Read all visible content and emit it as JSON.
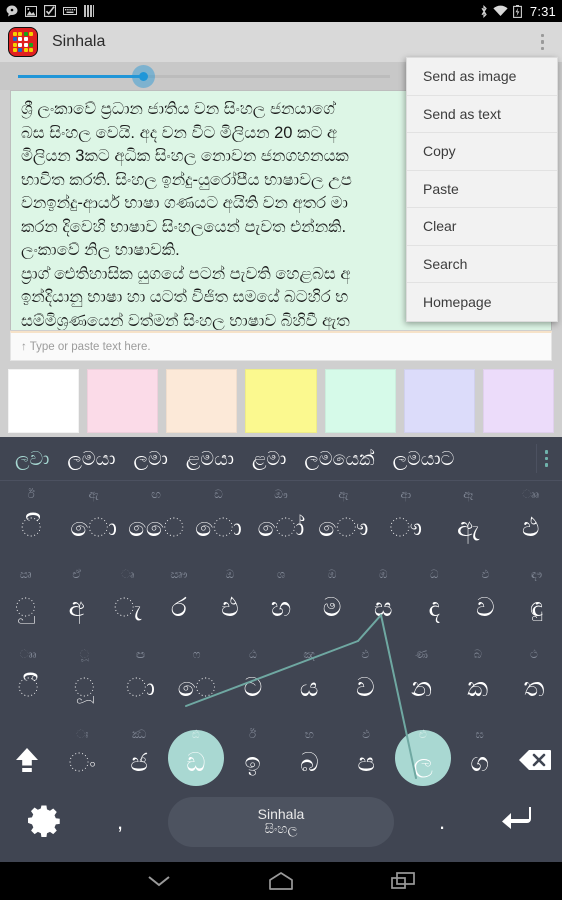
{
  "status_bar": {
    "time": "7:31",
    "left_icons": [
      "message-icon",
      "image-icon",
      "checkbox-icon",
      "keyboard-icon",
      "sim-icon"
    ],
    "right_icons": [
      "bluetooth-icon",
      "wifi-icon",
      "battery-charging-icon"
    ]
  },
  "app_bar": {
    "title": "Sinhala",
    "overflow_label": "More options"
  },
  "seek": {
    "value_percent": 34
  },
  "editor": {
    "lines": [
      "ශ්‍රී ලංකාවේ ප්‍රධාන ජාතිය වන සිංහල ජනයාගේ ",
      "බස සිංහල වෙයි. අද වන විට මිලියන 20 කට අ",
      "මිලියන 3කට අධික සිංහල නොවන ජනගහනයක",
      "භාවිත කරති. සිංහල ඉන්දු-යුරෝපීය භාෂාවල උප",
      "වනඉන්දු-ආර්ය භාෂා ගණයට අයිති වන අතර මා",
      "කරන දිවෙහි භාෂාව සිංහලයෙන් පැවත එන්නකි.",
      "ලංකාවේ නිල භාෂාවකි.",
      "ප්‍රාග් ඓතිහාසික යුගයේ පටන් පැවති හෙළබස අ",
      "ඉන්දියානු භාෂා හා යටත් විජිත සමයේ බටහිර භ",
      "සම්මිශ්‍රණයෙන් වත්මන් සිංහල භාෂාව බිහිවී ඇත"
    ],
    "hint": "↑ Type or paste text here."
  },
  "palette": {
    "swatches": [
      {
        "name": "white",
        "color": "#ffffff"
      },
      {
        "name": "pink",
        "color": "#fbdbe8"
      },
      {
        "name": "peach",
        "color": "#fce9d8"
      },
      {
        "name": "yellow",
        "color": "#fbf98f"
      },
      {
        "name": "mint",
        "color": "#d6fae9"
      },
      {
        "name": "lilac",
        "color": "#dcdcfa"
      },
      {
        "name": "violet",
        "color": "#ecdcfa"
      }
    ]
  },
  "menu": {
    "items": [
      "Send as image",
      "Send as text",
      "Copy",
      "Paste",
      "Clear",
      "Search",
      "Homepage"
    ]
  },
  "keyboard": {
    "suggestions": [
      {
        "text": "ලවා",
        "active": true
      },
      {
        "text": "ලමයා",
        "active": false
      },
      {
        "text": "ලමා",
        "active": false
      },
      {
        "text": "ළමයා",
        "active": false
      },
      {
        "text": "ළමා",
        "active": false
      },
      {
        "text": "ලමයෙක්",
        "active": false
      },
      {
        "text": "ලමයාට",
        "active": false
      }
    ],
    "rows": [
      [
        {
          "hint": "ඊ",
          "main": "ි",
          "pressed": false
        },
        {
          "hint": "ඇ",
          "main": "ො",
          "pressed": false
        },
        {
          "hint": "ඟ",
          "main": "ෙෙ",
          "pressed": false
        },
        {
          "hint": "ඩ",
          "main": "ො",
          "pressed": false
        },
        {
          "hint": "ඖ",
          "main": "ෝ",
          "pressed": false
        },
        {
          "hint": "ඇ",
          "main": "ෞ",
          "pressed": false
        },
        {
          "hint": "ආ",
          "main": "ෟ",
          "pressed": false
        },
        {
          "hint": "ඈ",
          "main": "ඇ",
          "pressed": false
        },
        {
          "hint": "ෲ",
          "main": "ඵ",
          "pressed": false
        }
      ],
      [
        {
          "hint": "ඍ",
          "main": "ු",
          "pressed": false
        },
        {
          "hint": "ඒ",
          "main": "අ",
          "pressed": false
        },
        {
          "hint": "ෘ",
          "main": "ැ",
          "pressed": false
        },
        {
          "hint": "ඍෟ",
          "main": "ර",
          "pressed": false
        },
        {
          "hint": "ඔ",
          "main": "එ",
          "pressed": false
        },
        {
          "hint": "ශ",
          "main": "හ",
          "pressed": false
        },
        {
          "hint": "ඹ",
          "main": "ම",
          "pressed": false
        },
        {
          "hint": "ඹ",
          "main": "ස",
          "pressed": false
        },
        {
          "hint": "ධ",
          "main": "ද",
          "pressed": false
        },
        {
          "hint": "ඵ",
          "main": "ව",
          "pressed": false
        },
        {
          "hint": "ඳෟ",
          "main": "ඳු",
          "pressed": false
        }
      ],
      [
        {
          "hint": "ෲ",
          "main": "ී",
          "pressed": false
        },
        {
          "hint": "ූ",
          "main": "ූ",
          "pressed": false
        },
        {
          "hint": "ඏ",
          "main": "ා",
          "pressed": false
        },
        {
          "hint": "ෆ",
          "main": "ෙ",
          "pressed": false
        },
        {
          "hint": "ඨ",
          "main": "ට",
          "pressed": false
        },
        {
          "hint": "ඤ",
          "main": "ය",
          "pressed": false
        },
        {
          "hint": "ඵ",
          "main": "ව",
          "pressed": false
        },
        {
          "hint": "ණ",
          "main": "න",
          "pressed": false
        },
        {
          "hint": "බ",
          "main": "ක",
          "pressed": false
        },
        {
          "hint": "ථ",
          "main": "ත",
          "pressed": false
        }
      ]
    ],
    "row4": {
      "shift_icon": "shift-icon",
      "backspace_icon": "backspace-icon",
      "keys": [
        {
          "hint": "ඃ",
          "main": "ං",
          "pressed": false
        },
        {
          "hint": "ඣ",
          "main": "ජ",
          "pressed": false
        },
        {
          "hint": "ඪ",
          "main": "ඩ",
          "pressed": true
        },
        {
          "hint": "ඊ",
          "main": "ඉ",
          "pressed": false
        },
        {
          "hint": "භ",
          "main": "බ",
          "pressed": false
        },
        {
          "hint": "ඵ",
          "main": "ප",
          "pressed": false
        },
        {
          "hint": "ළු",
          "main": "ල",
          "pressed": true
        },
        {
          "hint": "ඝ",
          "main": "ග",
          "pressed": false
        }
      ]
    },
    "row5": {
      "settings_icon": "gear-icon",
      "comma": ",",
      "space_primary": "Sinhala",
      "space_secondary": "සිංහල",
      "period": ".",
      "enter_icon": "enter-icon"
    }
  },
  "nav_bar": {
    "back_icon": "keyboard-dismiss-icon",
    "home_icon": "home-icon",
    "recents_icon": "recents-icon"
  },
  "colors": {
    "accent": "#2196d8",
    "keyboard_bg": "#404552",
    "key_press": "#a9d8d2",
    "editor_bg": "#ddf6e6",
    "appbar_bg": "#d9d9d9"
  }
}
